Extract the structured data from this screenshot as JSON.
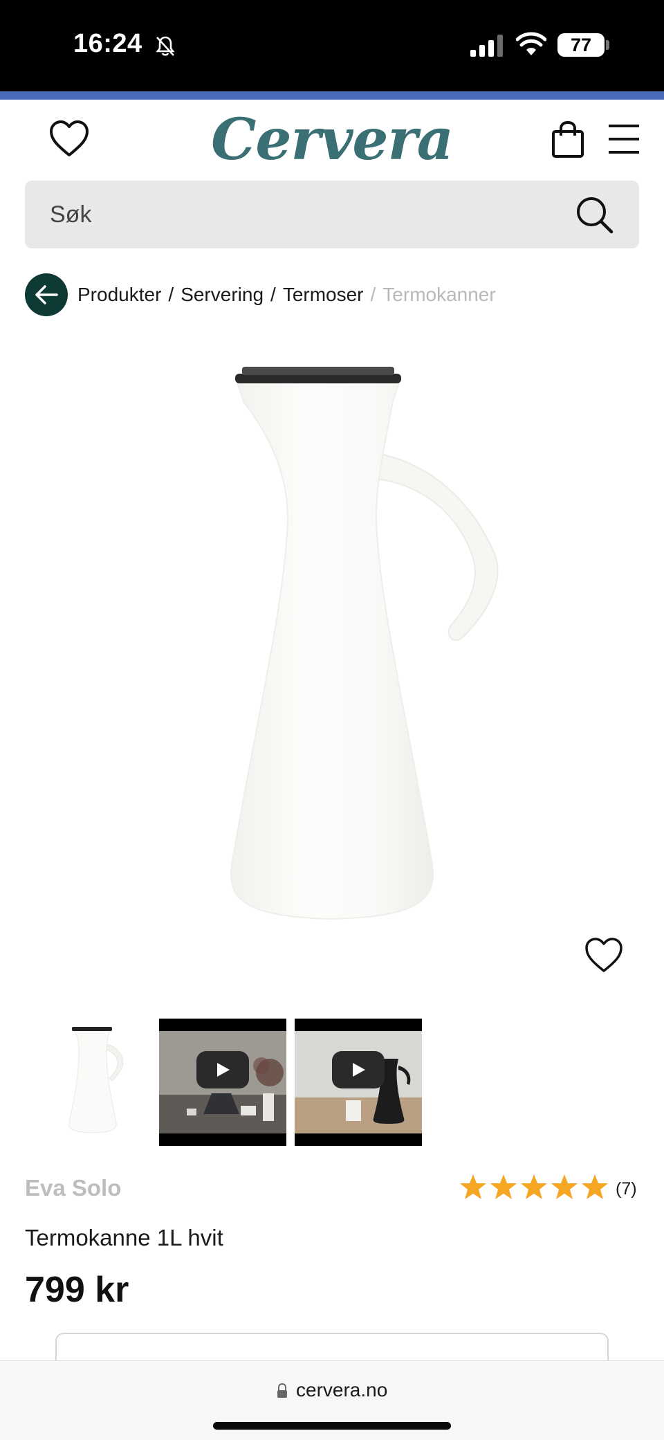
{
  "status_bar": {
    "time": "16:24",
    "battery": "77"
  },
  "header": {
    "logo": "Cervera",
    "brand_color": "#3a6f74"
  },
  "search": {
    "placeholder": "Søk"
  },
  "breadcrumb": {
    "items": [
      "Produkter",
      "Servering",
      "Termoser"
    ],
    "current": "Termokanner"
  },
  "thumbnails": [
    {
      "type": "image",
      "icon": "product-thumbnail"
    },
    {
      "type": "video",
      "icon": "play-icon"
    },
    {
      "type": "video",
      "icon": "play-icon"
    }
  ],
  "product": {
    "brand": "Eva Solo",
    "name": "Termokanne 1L hvit",
    "price": "799 kr",
    "rating": 5,
    "rating_max": 5,
    "review_count": "(7)",
    "star_color": "#f5a623"
  },
  "browser": {
    "url": "cervera.no"
  }
}
